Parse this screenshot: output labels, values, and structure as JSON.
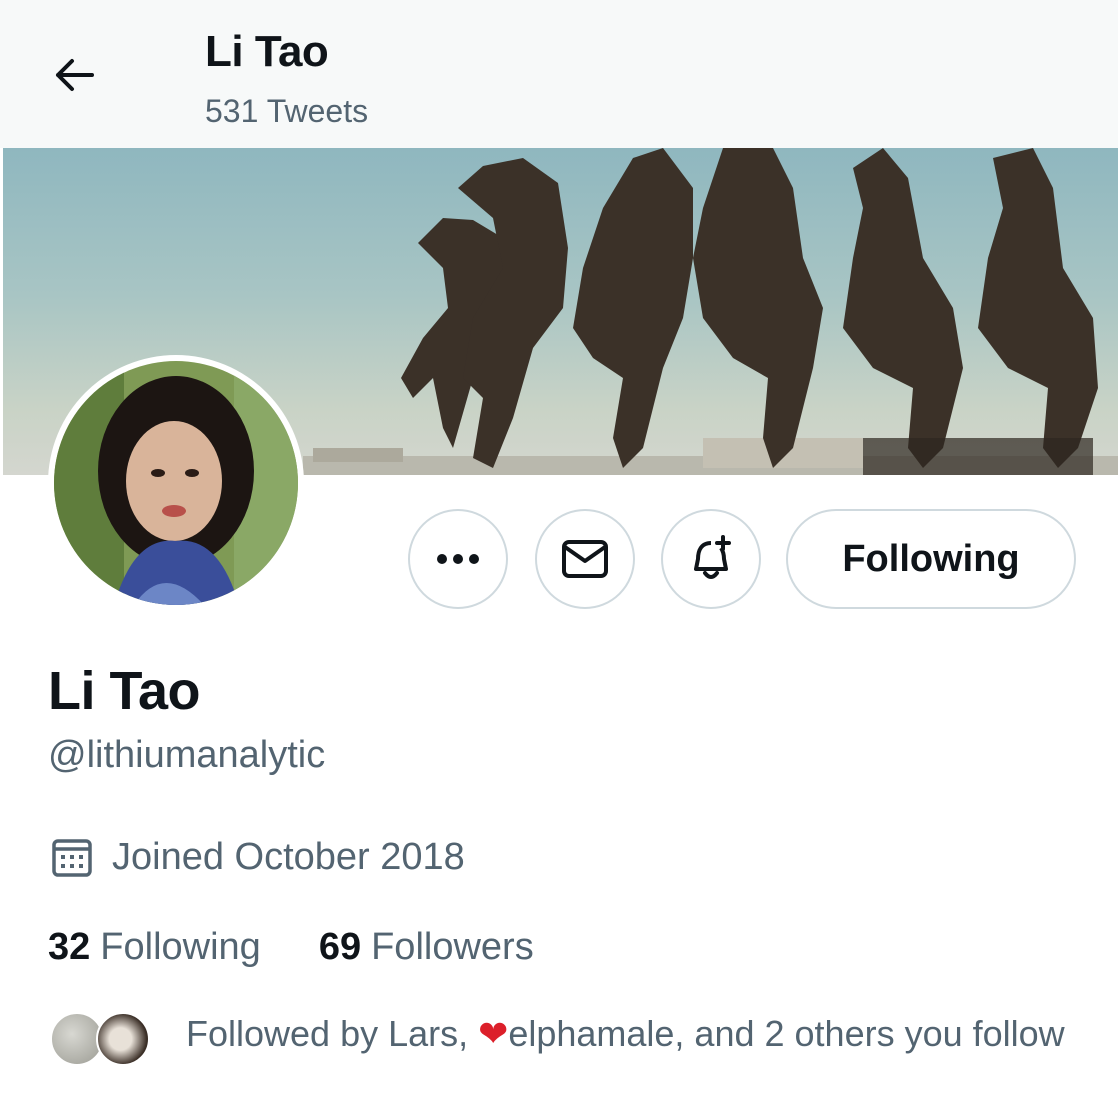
{
  "header": {
    "back_icon": "arrow-left-icon",
    "title": "Li Tao",
    "tweet_count": "531 Tweets"
  },
  "banner": {
    "description_icon": "banner-image"
  },
  "actions": {
    "more_icon": "more-horizontal-icon",
    "message_icon": "envelope-icon",
    "notify_icon": "bell-plus-icon",
    "following_label": "Following"
  },
  "profile": {
    "name": "Li Tao",
    "handle": "@lithiumanalytic",
    "joined_icon": "calendar-icon",
    "joined": "Joined October 2018"
  },
  "stats": {
    "following_count": "32",
    "following_label": "Following",
    "followers_count": "69",
    "followers_label": "Followers"
  },
  "followed_by": {
    "prefix": "Followed by Lars, ",
    "heart": "❤",
    "suffix": "elphamale, and 2 others you follow"
  },
  "colors": {
    "text_primary": "#0f1419",
    "text_secondary": "#536471",
    "border": "#cfd9de",
    "heart": "#dc1f2a"
  }
}
